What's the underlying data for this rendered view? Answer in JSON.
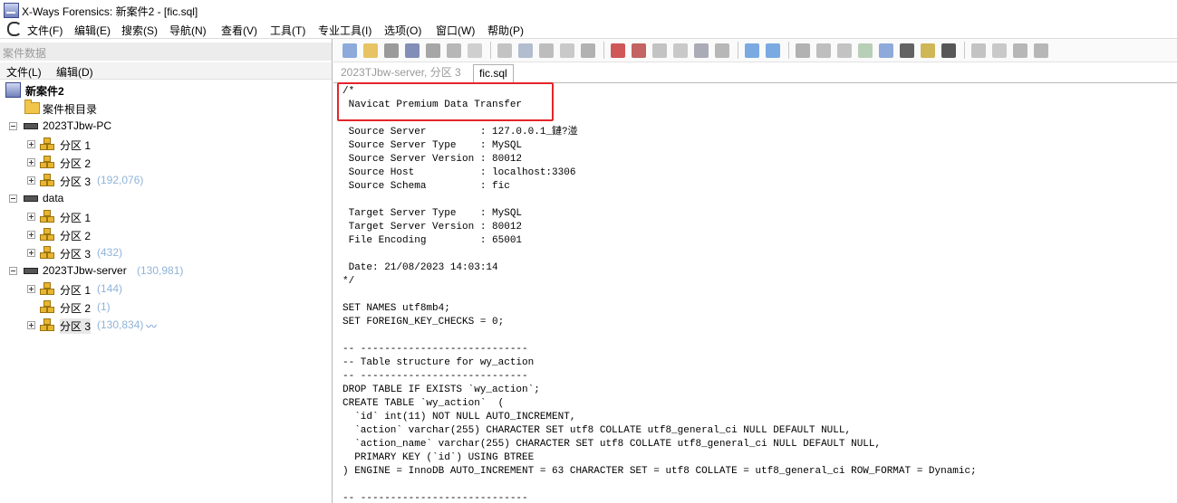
{
  "window": {
    "title": "X-Ways Forensics: 新案件2 - [fic.sql]"
  },
  "menu": {
    "items": [
      "文件(F)",
      "编辑(E)",
      "搜索(S)",
      "导航(N)",
      "查看(V)",
      "工具(T)",
      "专业工具(I)",
      "选项(O)",
      "窗口(W)",
      "帮助(P)"
    ]
  },
  "case_pane": {
    "header": "案件数据",
    "menu": [
      "文件(L)",
      "编辑(D)"
    ],
    "tree": {
      "root": "新案件2",
      "root_dir": "案件根目录",
      "evidence": [
        {
          "name": "2023TJbw-PC",
          "count": "",
          "partitions": [
            {
              "name": "分区 1",
              "count": ""
            },
            {
              "name": "分区 2",
              "count": ""
            },
            {
              "name": "分区 3",
              "count": "(192,076)"
            }
          ]
        },
        {
          "name": "data",
          "count": "",
          "partitions": [
            {
              "name": "分区 1",
              "count": ""
            },
            {
              "name": "分区 2",
              "count": ""
            },
            {
              "name": "分区 3",
              "count": "(432)"
            }
          ]
        },
        {
          "name": "2023TJbw-server",
          "count": "(130,981)",
          "partitions": [
            {
              "name": "分区 1",
              "count": "(144)"
            },
            {
              "name": "分区 2",
              "count": "(1)"
            },
            {
              "name": "分区 3",
              "count": "(130,834)"
            }
          ]
        }
      ]
    }
  },
  "tabs": [
    {
      "label": "2023TJbw-server, 分区 3",
      "active": false
    },
    {
      "label": "fic.sql",
      "active": true
    }
  ],
  "toolbar_icons": [
    "new-file-icon",
    "open-folder-icon",
    "save-icon",
    "print-icon",
    "properties-icon",
    "copy-icon",
    "paste-icon",
    "undo-icon",
    "clipboard-icon",
    "copy-block-icon",
    "export-icon",
    "hex-icon",
    "find-icon",
    "find-text-icon",
    "find-hex-icon",
    "replace-icon",
    "goto-offset-icon",
    "goto-sector-icon",
    "back-icon",
    "forward-icon",
    "refresh-icon",
    "snapshot-icon",
    "hash-icon",
    "calc-icon",
    "search-icon",
    "camera-icon",
    "settings-icon",
    "gear-icon",
    "grid-icon",
    "layout-icon",
    "prev-icon",
    "next-icon"
  ],
  "editor": {
    "lines": [
      "/*",
      " Navicat Premium Data Transfer",
      "",
      " Source Server         : 127.0.0.1_鏈?湴",
      " Source Server Type    : MySQL",
      " Source Server Version : 80012",
      " Source Host           : localhost:3306",
      " Source Schema         : fic",
      "",
      " Target Server Type    : MySQL",
      " Target Server Version : 80012",
      " File Encoding         : 65001",
      "",
      " Date: 21/08/2023 14:03:14",
      "*/",
      "",
      "SET NAMES utf8mb4;",
      "SET FOREIGN_KEY_CHECKS = 0;",
      "",
      "-- ----------------------------",
      "-- Table structure for wy_action",
      "-- ----------------------------",
      "DROP TABLE IF EXISTS `wy_action`;",
      "CREATE TABLE `wy_action`  (",
      "  `id` int(11) NOT NULL AUTO_INCREMENT,",
      "  `action` varchar(255) CHARACTER SET utf8 COLLATE utf8_general_ci NULL DEFAULT NULL,",
      "  `action_name` varchar(255) CHARACTER SET utf8 COLLATE utf8_general_ci NULL DEFAULT NULL,",
      "  PRIMARY KEY (`id`) USING BTREE",
      ") ENGINE = InnoDB AUTO_INCREMENT = 63 CHARACTER SET = utf8 COLLATE = utf8_general_ci ROW_FORMAT = Dynamic;",
      "",
      "-- ----------------------------"
    ]
  },
  "colors": {
    "highlight": "#e5252a",
    "count_text": "#8fb4d8"
  }
}
